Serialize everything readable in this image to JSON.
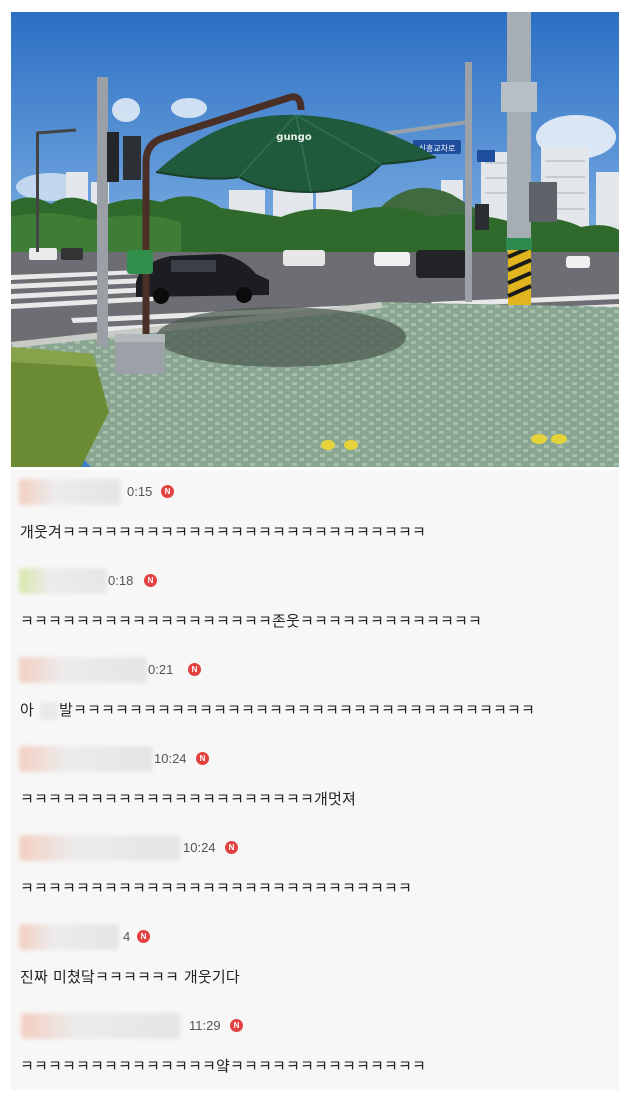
{
  "photo": {
    "street_sign_text": "신흥교차로",
    "umbrella_brand": "gungo"
  },
  "comments": [
    {
      "time": "0:15",
      "text": "개웃겨ㅋㅋㅋㅋㅋㅋㅋㅋㅋㅋㅋㅋㅋㅋㅋㅋㅋㅋㅋㅋㅋㅋㅋㅋㅋㅋ",
      "badge": "N"
    },
    {
      "time": "0:18",
      "text": "ㅋㅋㅋㅋㅋㅋㅋㅋㅋㅋㅋㅋㅋㅋㅋㅋㅋㅋ존웃ㅋㅋㅋㅋㅋㅋㅋㅋㅋㅋㅋㅋㅋ",
      "badge": "N"
    },
    {
      "time": "0:21",
      "text_prefix": "아",
      "text": "발ㅋㅋㅋㅋㅋㅋㅋㅋㅋㅋㅋㅋㅋㅋㅋㅋㅋㅋㅋㅋㅋㅋㅋㅋㅋㅋㅋㅋㅋㅋㅋㅋㅋ",
      "badge": "N"
    },
    {
      "time": "10:24",
      "text": "ㅋㅋㅋㅋㅋㅋㅋㅋㅋㅋㅋㅋㅋㅋㅋㅋㅋㅋㅋㅋㅋ개멋져",
      "badge": "N"
    },
    {
      "time": "10:24",
      "text": "ㅋㅋㅋㅋㅋㅋㅋㅋㅋㅋㅋㅋㅋㅋㅋㅋㅋㅋㅋㅋㅋㅋㅋㅋㅋㅋㅋㅋ",
      "badge": "N"
    },
    {
      "time": "4",
      "text": "진짜 미쳤닼ㅋㅋㅋㅋㅋㅋ 개웃기다",
      "badge": "N"
    },
    {
      "time": "11:29",
      "text": "ㅋㅋㅋㅋㅋㅋㅋㅋㅋㅋㅋㅋㅋㅋ얔ㅋㅋㅋㅋㅋㅋㅋㅋㅋㅋㅋㅋㅋㅋ",
      "badge": "N"
    }
  ]
}
